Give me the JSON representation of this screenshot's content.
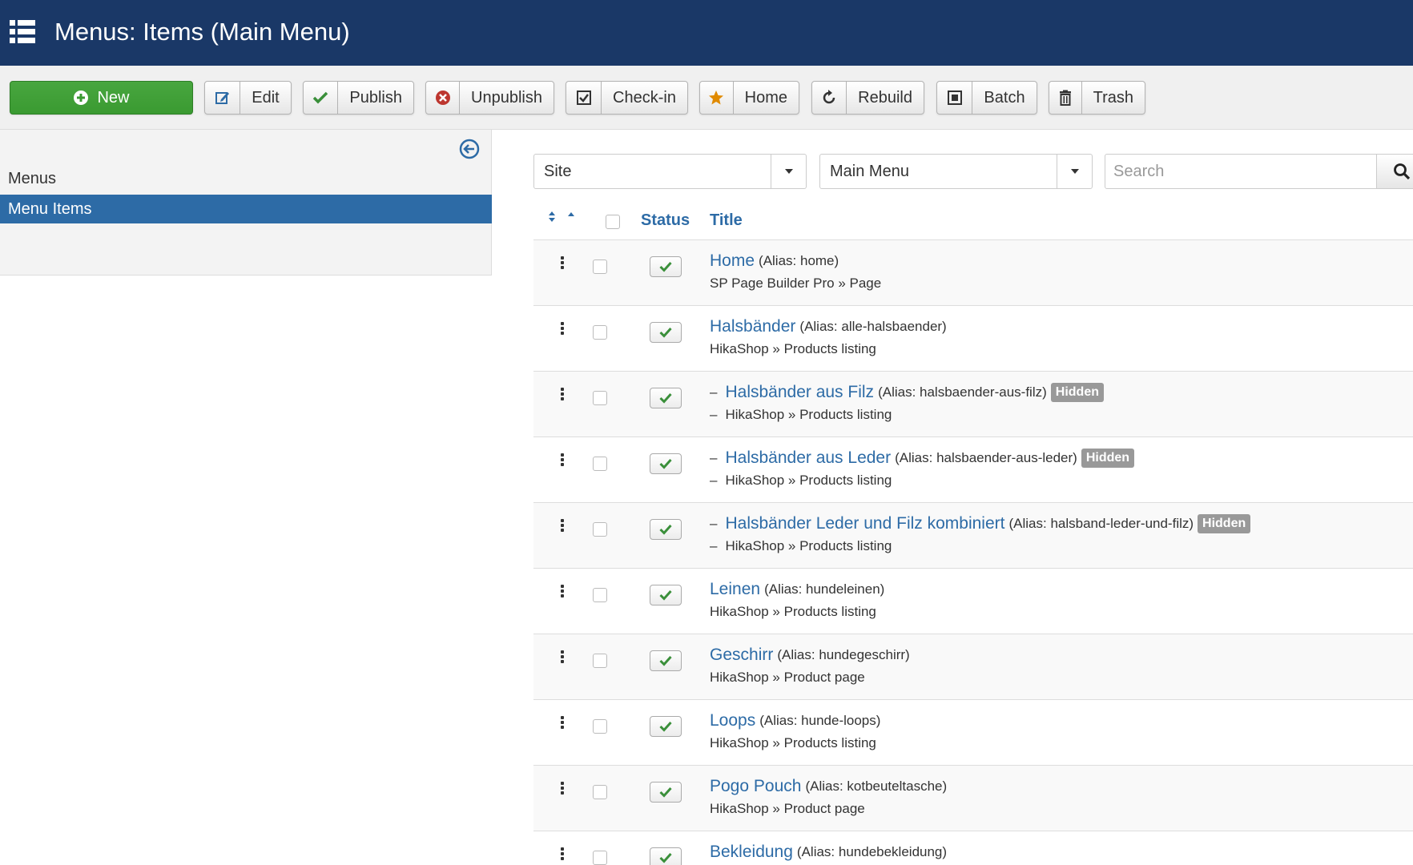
{
  "header": {
    "title": "Menus: Items (Main Menu)"
  },
  "toolbar": {
    "new": "New",
    "edit": "Edit",
    "publish": "Publish",
    "unpublish": "Unpublish",
    "checkin": "Check-in",
    "home": "Home",
    "rebuild": "Rebuild",
    "batch": "Batch",
    "trash": "Trash"
  },
  "sidebar": {
    "items": [
      {
        "label": "Menus"
      },
      {
        "label": "Menu Items"
      }
    ]
  },
  "filters": {
    "client": "Site",
    "menu": "Main Menu",
    "search_placeholder": "Search"
  },
  "table": {
    "headers": {
      "status": "Status",
      "title": "Title"
    },
    "rows": [
      {
        "title": "Home",
        "alias": "(Alias: home)",
        "type": "SP Page Builder Pro » Page",
        "hidden": "",
        "level": 1
      },
      {
        "title": "Halsbänder",
        "alias": "(Alias: alle-halsbaender)",
        "type": "HikaShop » Products listing",
        "hidden": "",
        "level": 1
      },
      {
        "title": "Halsbänder aus Filz",
        "alias": "(Alias: halsbaender-aus-filz)",
        "type": "HikaShop » Products listing",
        "hidden": "Hidden",
        "level": 2
      },
      {
        "title": "Halsbänder aus Leder",
        "alias": "(Alias: halsbaender-aus-leder)",
        "type": "HikaShop » Products listing",
        "hidden": "Hidden",
        "level": 2
      },
      {
        "title": "Halsbänder Leder und Filz kombiniert",
        "alias": "(Alias: halsband-leder-und-filz)",
        "type": "HikaShop » Products listing",
        "hidden": "Hidden",
        "level": 2
      },
      {
        "title": "Leinen",
        "alias": "(Alias: hundeleinen)",
        "type": "HikaShop » Products listing",
        "hidden": "",
        "level": 1
      },
      {
        "title": "Geschirr",
        "alias": "(Alias: hundegeschirr)",
        "type": "HikaShop » Product page",
        "hidden": "",
        "level": 1
      },
      {
        "title": "Loops",
        "alias": "(Alias: hunde-loops)",
        "type": "HikaShop » Products listing",
        "hidden": "",
        "level": 1
      },
      {
        "title": "Pogo Pouch",
        "alias": "(Alias: kotbeuteltasche)",
        "type": "HikaShop » Product page",
        "hidden": "",
        "level": 1
      },
      {
        "title": "Bekleidung",
        "alias": "(Alias: hundebekleidung)",
        "type": "",
        "hidden": "",
        "level": 1
      }
    ]
  },
  "colors": {
    "header_bg": "#1a3867",
    "accent": "#2d6ba6",
    "new_button": "#3a9a31",
    "published_check": "#3a8f3a",
    "badge": "#999999"
  },
  "icons": {
    "menu": "list-icon",
    "new": "plus-circle-icon",
    "edit": "edit-icon",
    "publish": "check-icon",
    "unpublish": "x-circle-icon",
    "checkin": "checkbox-icon",
    "home": "star-icon",
    "rebuild": "refresh-icon",
    "batch": "square-icon",
    "trash": "trash-icon",
    "collapse": "arrow-left-circle-icon",
    "search": "search-icon"
  }
}
